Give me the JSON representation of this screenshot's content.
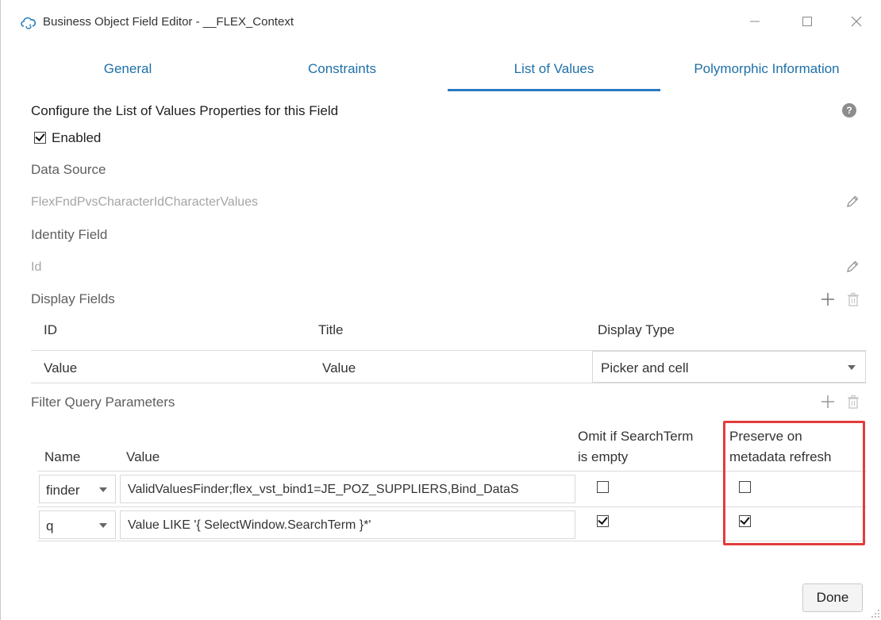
{
  "window": {
    "title": "Business Object Field Editor - __FLEX_Context",
    "icons": {
      "app": "cloud-refresh-icon",
      "minimize": "minimize-icon",
      "maximize": "maximize-icon",
      "close": "close-icon"
    }
  },
  "tabs": [
    {
      "label": "General",
      "active": false
    },
    {
      "label": "Constraints",
      "active": false
    },
    {
      "label": "List of Values",
      "active": true
    },
    {
      "label": "Polymorphic Information",
      "active": false
    }
  ],
  "accent_color": "#2a78c2",
  "highlight_color": "#e23c3c",
  "lov": {
    "heading": "Configure the List of Values Properties for this Field",
    "enabled": {
      "label": "Enabled",
      "checked": true
    },
    "data_source": {
      "label": "Data Source",
      "value": "FlexFndPvsCharacterIdCharacterValues"
    },
    "identity_field": {
      "label": "Identity Field",
      "value": "Id"
    },
    "display_fields": {
      "label": "Display Fields",
      "columns": [
        "ID",
        "Title",
        "Display Type"
      ],
      "rows": [
        {
          "id": "Value",
          "title": "Value",
          "display_type": "Picker and cell"
        }
      ]
    },
    "filter_query": {
      "label": "Filter Query Parameters",
      "columns": {
        "name": "Name",
        "value": "Value",
        "omit_line1": "Omit if SearchTerm",
        "omit_line2": "is empty",
        "preserve_line1": "Preserve on",
        "preserve_line2": "metadata refresh"
      },
      "rows": [
        {
          "name": "finder",
          "value": "ValidValuesFinder;flex_vst_bind1=JE_POZ_SUPPLIERS,Bind_DataS",
          "omit": false,
          "preserve": false
        },
        {
          "name": "q",
          "value": "Value LIKE '{ SelectWindow.SearchTerm }*'",
          "omit": true,
          "preserve": true
        }
      ]
    }
  },
  "footer": {
    "done_label": "Done"
  }
}
